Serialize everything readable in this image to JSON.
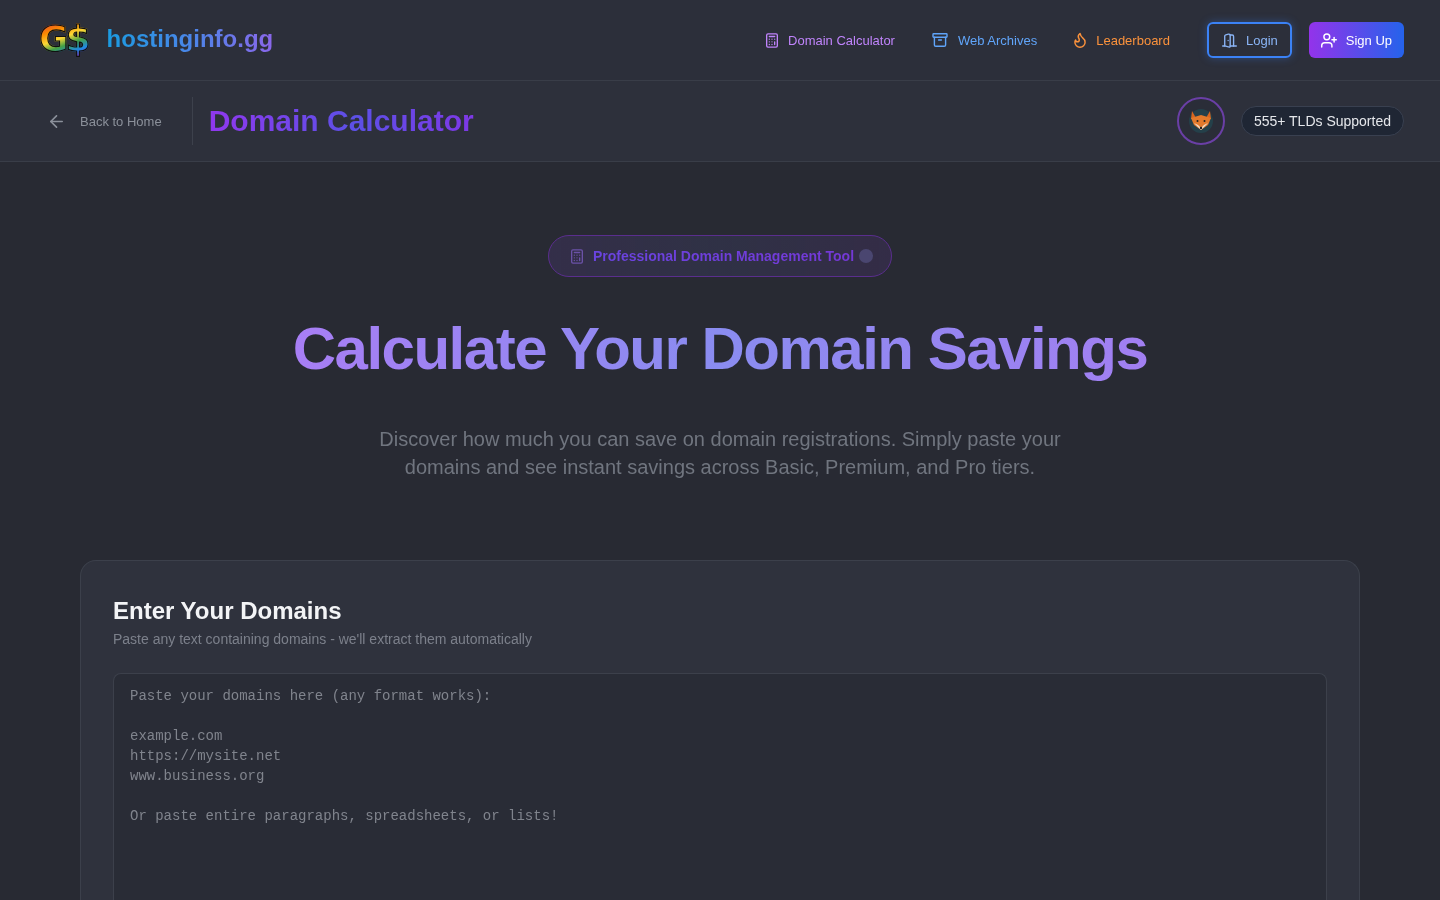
{
  "header": {
    "logo_mark": "G$",
    "site_name": "hostinginfo.gg",
    "nav": [
      {
        "kind": "calculator",
        "label": "Domain Calculator",
        "color": "#c084fc"
      },
      {
        "kind": "archive",
        "label": "Web Archives",
        "color": "#60a5fa"
      },
      {
        "kind": "flame",
        "label": "Leaderboard",
        "color": "#fb923c"
      }
    ],
    "buttons": [
      {
        "kind": "outline",
        "label": "Login"
      },
      {
        "kind": "primary",
        "label": "Sign Up"
      }
    ]
  },
  "subheader": {
    "back_link": "Back to Home",
    "title": "Domain Calculator",
    "tld_badge": "555+ TLDs Supported"
  },
  "hero": {
    "badge": "Professional Domain Management Tool",
    "title": "Calculate Your Domain Savings",
    "subtitle": "Discover how much you can save on domain registrations. Simply paste your domains and see instant savings across Basic, Premium, and Pro tiers."
  },
  "input_card": {
    "title": "Enter Your Domains",
    "subtitle": "Paste any text containing domains - we'll extract them automatically",
    "textarea": {
      "placeholder": "Paste your domains here (any format works):\n\nexample.com\nhttps://mysite.net\nwww.business.org\n\nOr paste entire paragraphs, spreadsheets, or lists!"
    }
  }
}
